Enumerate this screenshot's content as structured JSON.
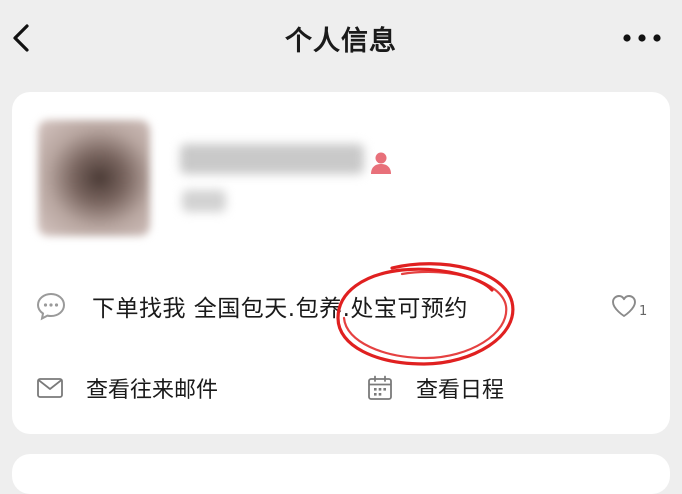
{
  "header": {
    "title": "个人信息",
    "back_icon": "chevron-left-icon",
    "more_icon": "more-horizontal-icon"
  },
  "profile": {
    "name": "********",
    "id": "***",
    "avatar_blurred": true,
    "gender_icon": "person-icon",
    "gender_color": "#e8707a"
  },
  "signature": {
    "icon": "comment-bubble-icon",
    "text": "下单找我  全国包天.包养.处宝可预约"
  },
  "like": {
    "icon": "heart-outline-icon",
    "count": "1"
  },
  "annotation": {
    "type": "hand-drawn-circle",
    "color": "#e02020"
  },
  "actions": [
    {
      "label": "查看往来邮件",
      "icon": "mail-icon"
    },
    {
      "label": "查看日程",
      "icon": "calendar-icon"
    }
  ],
  "colors": {
    "background": "#eeeeee",
    "card": "#ffffff"
  }
}
